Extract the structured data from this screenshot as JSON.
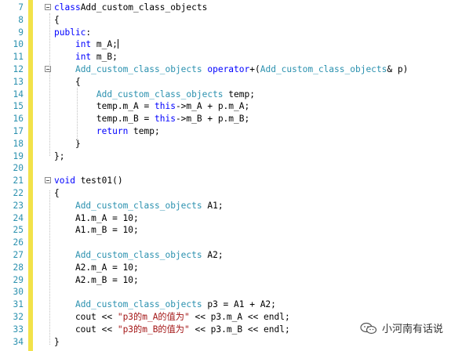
{
  "editor": {
    "lines": [
      {
        "n": "7",
        "fold": true,
        "segments": [
          [
            "kw",
            "class"
          ],
          [
            "",
            "Add_custom_class_objects"
          ]
        ]
      },
      {
        "n": "8",
        "fold": false,
        "segments": [
          [
            "",
            "{"
          ]
        ]
      },
      {
        "n": "9",
        "fold": false,
        "segments": [
          [
            "kw",
            "public"
          ],
          [
            "",
            ":"
          ]
        ]
      },
      {
        "n": "10",
        "fold": false,
        "segments": [
          [
            "",
            "    "
          ],
          [
            "kw",
            "int"
          ],
          [
            "",
            " m_A;"
          ]
        ],
        "cursor": true
      },
      {
        "n": "11",
        "fold": false,
        "segments": [
          [
            "",
            "    "
          ],
          [
            "kw",
            "int"
          ],
          [
            "",
            " m_B;"
          ]
        ]
      },
      {
        "n": "12",
        "fold": true,
        "segments": [
          [
            "",
            "    "
          ],
          [
            "ty",
            "Add_custom_class_objects"
          ],
          [
            "",
            " "
          ],
          [
            "kw",
            "operator"
          ],
          [
            "",
            "+("
          ],
          [
            "ty",
            "Add_custom_class_objects"
          ],
          [
            "",
            "& p)"
          ]
        ]
      },
      {
        "n": "13",
        "fold": false,
        "segments": [
          [
            "",
            "    {"
          ]
        ]
      },
      {
        "n": "14",
        "fold": false,
        "segments": [
          [
            "",
            "        "
          ],
          [
            "ty",
            "Add_custom_class_objects"
          ],
          [
            "",
            " temp;"
          ]
        ]
      },
      {
        "n": "15",
        "fold": false,
        "segments": [
          [
            "",
            "        temp.m_A = "
          ],
          [
            "kw",
            "this"
          ],
          [
            "",
            "->m_A + p.m_A;"
          ]
        ]
      },
      {
        "n": "16",
        "fold": false,
        "segments": [
          [
            "",
            "        temp.m_B = "
          ],
          [
            "kw",
            "this"
          ],
          [
            "",
            "->m_B + p.m_B;"
          ]
        ]
      },
      {
        "n": "17",
        "fold": false,
        "segments": [
          [
            "",
            "        "
          ],
          [
            "kw",
            "return"
          ],
          [
            "",
            " temp;"
          ]
        ]
      },
      {
        "n": "18",
        "fold": false,
        "segments": [
          [
            "",
            "    }"
          ]
        ]
      },
      {
        "n": "19",
        "fold": false,
        "segments": [
          [
            "",
            "};"
          ]
        ]
      },
      {
        "n": "20",
        "fold": false,
        "segments": []
      },
      {
        "n": "21",
        "fold": true,
        "segments": [
          [
            "kw",
            "void"
          ],
          [
            "",
            " test01()"
          ]
        ]
      },
      {
        "n": "22",
        "fold": false,
        "segments": [
          [
            "",
            "{"
          ]
        ]
      },
      {
        "n": "23",
        "fold": false,
        "segments": [
          [
            "",
            "    "
          ],
          [
            "ty",
            "Add_custom_class_objects"
          ],
          [
            "",
            " A1;"
          ]
        ]
      },
      {
        "n": "24",
        "fold": false,
        "segments": [
          [
            "",
            "    A1.m_A = 10;"
          ]
        ]
      },
      {
        "n": "25",
        "fold": false,
        "segments": [
          [
            "",
            "    A1.m_B = 10;"
          ]
        ]
      },
      {
        "n": "26",
        "fold": false,
        "segments": []
      },
      {
        "n": "27",
        "fold": false,
        "segments": [
          [
            "",
            "    "
          ],
          [
            "ty",
            "Add_custom_class_objects"
          ],
          [
            "",
            " A2;"
          ]
        ]
      },
      {
        "n": "28",
        "fold": false,
        "segments": [
          [
            "",
            "    A2.m_A = 10;"
          ]
        ]
      },
      {
        "n": "29",
        "fold": false,
        "segments": [
          [
            "",
            "    A2.m_B = 10;"
          ]
        ]
      },
      {
        "n": "30",
        "fold": false,
        "segments": []
      },
      {
        "n": "31",
        "fold": false,
        "segments": [
          [
            "",
            "    "
          ],
          [
            "ty",
            "Add_custom_class_objects"
          ],
          [
            "",
            " p3 = A1 + A2;"
          ]
        ]
      },
      {
        "n": "32",
        "fold": false,
        "segments": [
          [
            "",
            "    cout << "
          ],
          [
            "str",
            "\"p3的m_A的值为\""
          ],
          [
            "",
            " << p3.m_A << endl;"
          ]
        ]
      },
      {
        "n": "33",
        "fold": false,
        "segments": [
          [
            "",
            "    cout << "
          ],
          [
            "str",
            "\"p3的m_B的值为\""
          ],
          [
            "",
            " << p3.m_B << endl;"
          ]
        ]
      },
      {
        "n": "34",
        "fold": false,
        "segments": [
          [
            "",
            "}"
          ]
        ]
      }
    ]
  },
  "watermark": {
    "text": "小河南有话说",
    "icon": "wechat-icon"
  },
  "colors": {
    "keyword": "#0000ff",
    "type": "#2b91af",
    "string": "#a31515",
    "line_number": "#2b91af",
    "change_bar": "#f2e24a"
  }
}
